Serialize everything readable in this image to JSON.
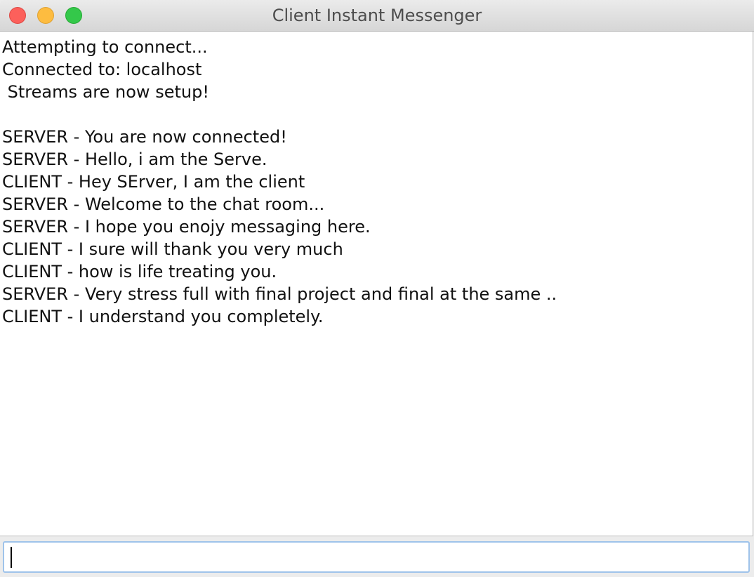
{
  "window": {
    "title": "Client Instant Messenger",
    "colors": {
      "close": "#fc605b",
      "minimize": "#fdbc40",
      "zoom": "#34c84a",
      "input_focus_border": "#9fc3ea"
    }
  },
  "chat": {
    "lines": [
      "Attempting to connect...",
      "Connected to: localhost",
      " Streams are now setup!",
      "",
      "SERVER - You are now connected!",
      "SERVER - Hello, i am the Serve.",
      "CLIENT - Hey SErver, I am the client",
      "SERVER - Welcome to the chat room...",
      "SERVER - I hope you enojy messaging here.",
      "CLIENT - I sure will thank you very much",
      "CLIENT - how is life treating you.",
      "SERVER - Very stress full with final project and final at the same ..",
      "CLIENT - I understand you completely."
    ]
  },
  "input": {
    "value": ""
  }
}
